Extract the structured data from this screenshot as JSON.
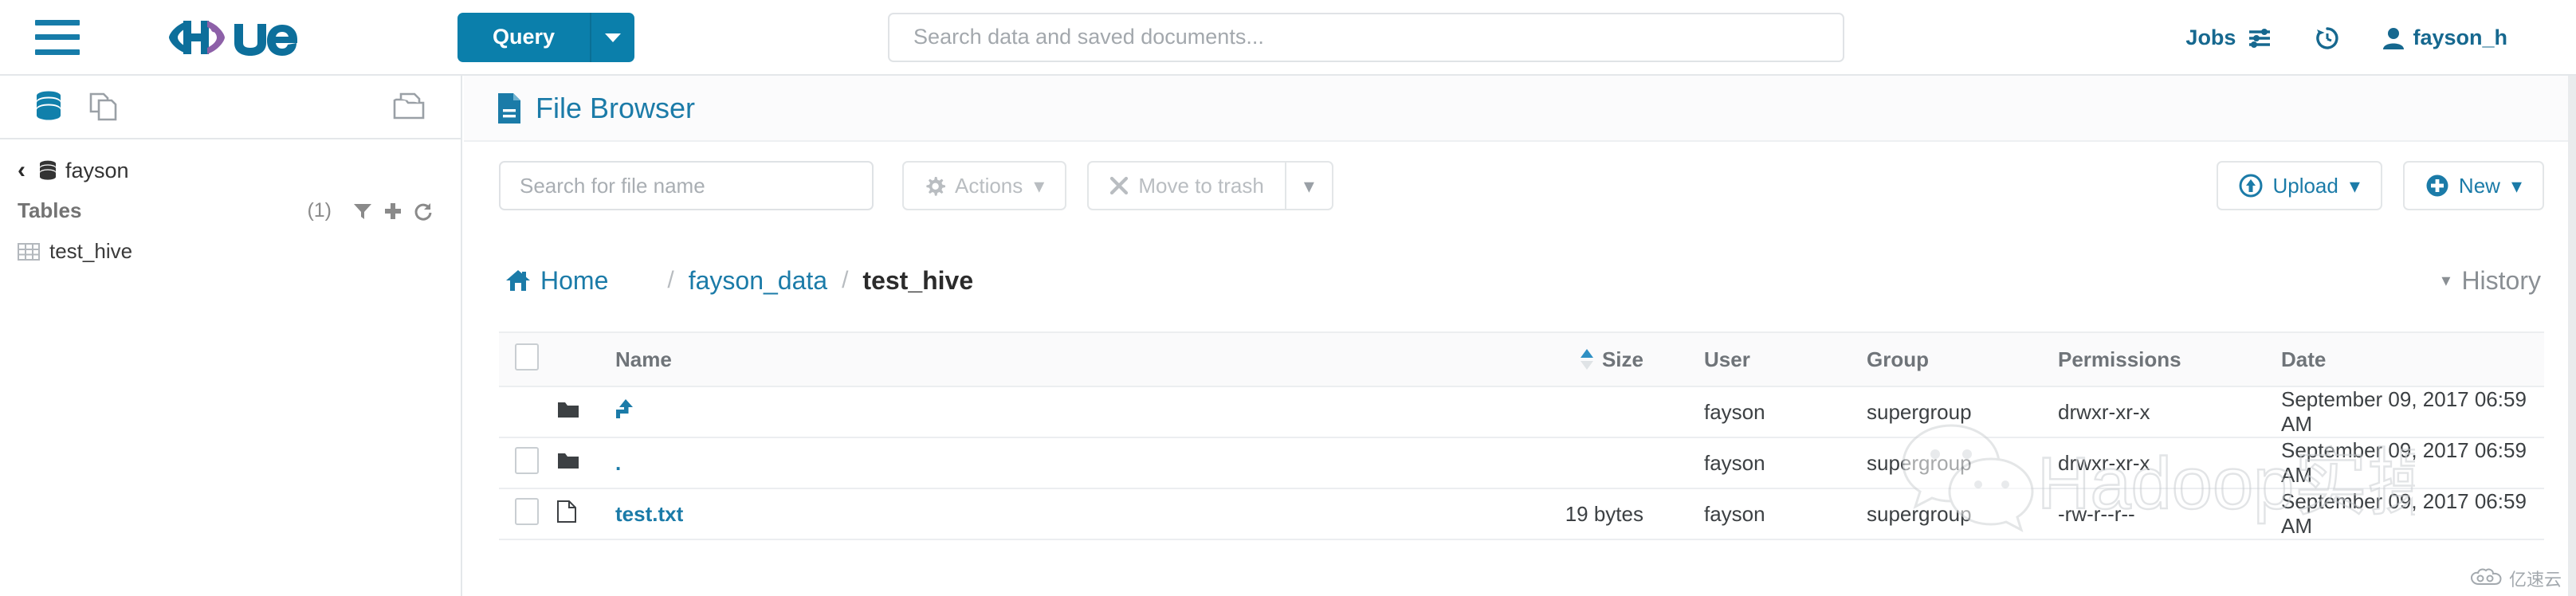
{
  "navbar": {
    "hamburger_icon": "hamburger-menu-icon",
    "logo_text": "hue",
    "query_button": {
      "label": "Query",
      "caret": "▾"
    },
    "global_search": {
      "placeholder": "Search data and saved documents...",
      "value": ""
    },
    "right_items": [
      {
        "label": "Jobs",
        "icon": "sliders-icon"
      },
      {
        "label": "",
        "icon": "history-clock-icon"
      },
      {
        "label": "fayson_h",
        "icon": "user-icon"
      }
    ]
  },
  "sidebar": {
    "tabs": [
      {
        "name": "database-tab",
        "icon": "database-icon",
        "active": true
      },
      {
        "name": "documents-tab",
        "icon": "documents-icon",
        "active": false
      }
    ],
    "folder_icon": "open-folder-icon",
    "breadcrumb": {
      "back_chevron": "‹",
      "icon": "database-icon",
      "label": "fayson"
    },
    "tables_header": {
      "label": "Tables",
      "count": "(1)",
      "actions": [
        "filter-icon",
        "plus-icon",
        "refresh-icon"
      ]
    },
    "tables": [
      {
        "label": "test_hive",
        "icon": "table-grid-icon"
      }
    ]
  },
  "main": {
    "page_title": {
      "label": "File Browser",
      "icon": "file-document-icon"
    },
    "toolbar": {
      "search": {
        "placeholder": "Search for file name",
        "value": ""
      },
      "actions_button": {
        "label": "Actions",
        "icon": "gear-icon",
        "caret": "▾",
        "disabled": true
      },
      "trash_button": {
        "label": "Move to trash",
        "icon": "x-icon",
        "disabled": true
      },
      "trash_caret": "▾",
      "upload_button": {
        "label": "Upload",
        "icon": "upload-circle-icon",
        "caret": "▾"
      },
      "new_button": {
        "label": "New",
        "icon": "plus-circle-icon",
        "caret": "▾"
      }
    },
    "breadcrumb": {
      "home": {
        "label": "Home",
        "icon": "home-icon"
      },
      "separator": "/",
      "items": [
        {
          "label": "fayson_data",
          "current": false
        },
        {
          "label": "test_hive",
          "current": true
        }
      ]
    },
    "history_toggle": {
      "label": "History",
      "caret": "▾"
    },
    "table": {
      "columns": [
        "Name",
        "Size",
        "User",
        "Group",
        "Permissions",
        "Date"
      ],
      "sort_column": "Size",
      "sort_direction": "asc",
      "rows": [
        {
          "selectable": false,
          "icon": "folder-icon",
          "name": "..",
          "name_display": "⤴",
          "size": "",
          "user": "fayson",
          "group": "supergroup",
          "permissions": "drwxr-xr-x",
          "date": "September 09, 2017 06:59 AM"
        },
        {
          "selectable": true,
          "icon": "folder-icon",
          "name": ".",
          "name_display": ".",
          "size": "",
          "user": "fayson",
          "group": "supergroup",
          "permissions": "drwxr-xr-x",
          "date": "September 09, 2017 06:59 AM"
        },
        {
          "selectable": true,
          "icon": "file-icon",
          "name": "test.txt",
          "name_display": "test.txt",
          "size": "19 bytes",
          "user": "fayson",
          "group": "supergroup",
          "permissions": "-rw-r--r--",
          "date": "September 09, 2017 06:59 AM"
        }
      ]
    }
  },
  "watermark": {
    "text": "Hadoop实操",
    "icon": "wechat-icon"
  },
  "corner_logo": {
    "text": "亿速云",
    "icon": "cloud-icon"
  },
  "colors": {
    "brand_blue": "#0b7fab",
    "link_blue": "#1b7ba8",
    "border_gray": "#e4e7ea",
    "muted_text": "#9aa0a6",
    "logo_purple": "#8d60a8"
  }
}
